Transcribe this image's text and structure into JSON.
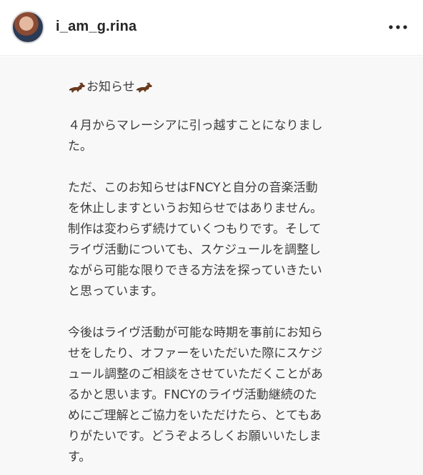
{
  "header": {
    "username": "i_am_g.rina",
    "more_icon": "ellipsis-icon"
  },
  "post": {
    "title_text": "お知らせ",
    "title_icon": "horse-emoji",
    "paragraphs": [
      "４月からマレーシアに引っ越すことになりました。",
      "ただ、このお知らせはFNCYと自分の音楽活動を休止しますというお知らせではありません。制作は変わらず続けていくつもりです。そしてライヴ活動についても、スケジュールを調整しながら可能な限りできる方法を探っていきたいと思っています。",
      "今後はライヴ活動が可能な時期を事前にお知らせをしたり、オファーをいただいた際にスケジュール調整のご相談をさせていただくことがあるかと思います。FNCYのライヴ活動継続のためにご理解とご協力をいただけたら、とてもありがたいです。どうぞよろしくお願いいたします。"
    ],
    "paragraph_lines": [
      "４月からマレーシアに引っ越すことになりまし\nた。",
      "ただ、このお知らせはFNCYと自分の音楽活動\nを休止しますというお知らせではありません。\n制作は変わらず続けていくつもりです。そして\nライヴ活動についても、スケジュールを調整し\nながら可能な限りできる方法を探っていきたい\nと思っています。",
      "今後はライヴ活動が可能な時期を事前にお知ら\nせをしたり、オファーをいただいた際にスケジ\nュール調整のご相談をさせていただくことがあ\nるかと思います。FNCYのライヴ活動継続のた\nめにご理解とご協力をいただけたら、とてもあ\nりがたいです。どうぞよろしくお願いいたしま\nす。"
    ]
  },
  "colors": {
    "text": "#3b3b3b",
    "username": "#262626",
    "background": "#f8f8f8",
    "divider": "#efefef"
  }
}
